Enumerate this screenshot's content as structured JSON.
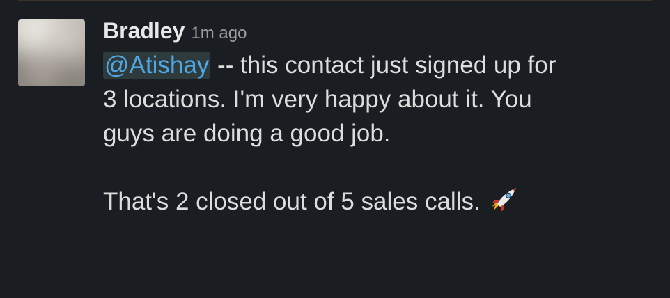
{
  "message": {
    "author": "Bradley",
    "timestamp": "1m ago",
    "mention": "@Atishay",
    "line1_rest": " -- this contact just signed up for",
    "line2": "3 locations. I'm very happy about it. You",
    "line3": "guys are doing a good job.",
    "paragraph2": "That's 2 closed out of 5 sales calls. ",
    "emoji": "rocket-icon"
  },
  "colors": {
    "background": "#1a1d21",
    "author": "#e8e8e8",
    "timestamp": "#9b9c9e",
    "body_text": "#dddddd",
    "mention_text": "#4fa6e0",
    "mention_background": "#2f3a3c"
  }
}
